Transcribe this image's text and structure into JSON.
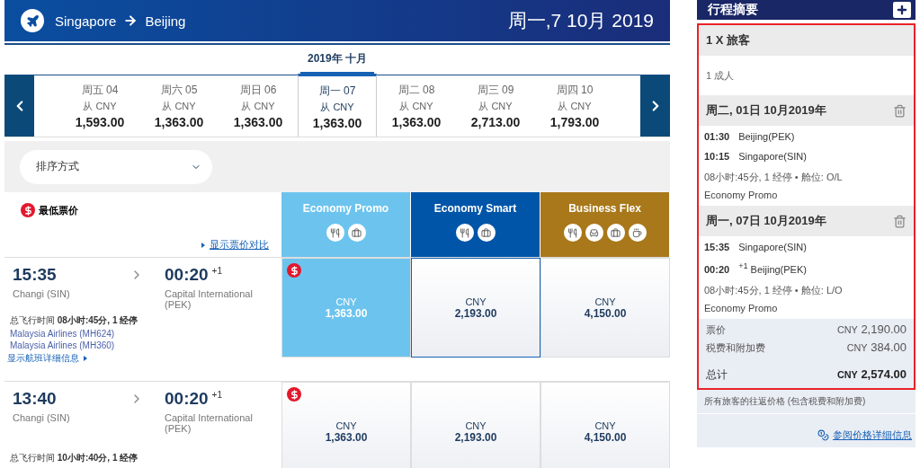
{
  "header": {
    "origin": "Singapore",
    "destination": "Beijing",
    "date": "周一,7 10月 2019"
  },
  "month_label": "2019年 十月",
  "dates": [
    {
      "day": "周五 04",
      "from": "从 CNY",
      "price": "1,593.00",
      "selected": false
    },
    {
      "day": "周六 05",
      "from": "从 CNY",
      "price": "1,363.00",
      "selected": false
    },
    {
      "day": "周日 06",
      "from": "从 CNY",
      "price": "1,363.00",
      "selected": false
    },
    {
      "day": "周一 07",
      "from": "从 CNY",
      "price": "1,363.00",
      "selected": true
    },
    {
      "day": "周二 08",
      "from": "从 CNY",
      "price": "1,363.00",
      "selected": false
    },
    {
      "day": "周三 09",
      "from": "从 CNY",
      "price": "2,713.00",
      "selected": false
    },
    {
      "day": "周四 10",
      "from": "从 CNY",
      "price": "1,793.00",
      "selected": false
    }
  ],
  "sort": {
    "label": "排序方式"
  },
  "lowest_fare_label": "最低票价",
  "compare_link": "显示票价对比",
  "fare_classes": [
    {
      "name": "Economy Promo",
      "color": "#6cc4ee",
      "amenities": [
        {
          "kind": "meal"
        },
        {
          "kind": "baggage"
        }
      ]
    },
    {
      "name": "Economy Smart",
      "color": "#0055a8",
      "amenities": [
        {
          "kind": "meal"
        },
        {
          "kind": "baggage"
        }
      ]
    },
    {
      "name": "Business Flex",
      "color": "#a8781a",
      "amenities": [
        {
          "kind": "meal"
        },
        {
          "kind": "seat"
        },
        {
          "kind": "baggage"
        },
        {
          "kind": "lounge"
        }
      ]
    }
  ],
  "flights": [
    {
      "depart": "15:35",
      "arrive": "00:20",
      "plus_day": "+1",
      "origin": "Changi (SIN)",
      "destination": "Capital International (PEK)",
      "duration_label": "总飞行时间",
      "duration": "08小时:45分, 1 经停",
      "airlines": [
        "Malaysia Airlines (MH624)",
        "Malaysia Airlines (MH360)"
      ],
      "details_link": "显示航班详细信息",
      "fares": [
        {
          "currency": "CNY",
          "price": "1,363.00",
          "lowest": true,
          "selected": true,
          "focused": false
        },
        {
          "currency": "CNY",
          "price": "2,193.00",
          "lowest": false,
          "selected": false,
          "focused": true
        },
        {
          "currency": "CNY",
          "price": "4,150.00",
          "lowest": false,
          "selected": false,
          "focused": false
        }
      ]
    },
    {
      "depart": "13:40",
      "arrive": "00:20",
      "plus_day": "+1",
      "origin": "Changi (SIN)",
      "destination": "Capital International (PEK)",
      "duration_label": "总飞行时间",
      "duration": "10小时:40分, 1 经停",
      "fares": [
        {
          "currency": "CNY",
          "price": "1,363.00",
          "lowest": true,
          "selected": false,
          "focused": false
        },
        {
          "currency": "CNY",
          "price": "2,193.00",
          "lowest": false,
          "selected": false,
          "focused": false
        },
        {
          "currency": "CNY",
          "price": "4,150.00",
          "lowest": false,
          "selected": false,
          "focused": false
        }
      ]
    }
  ],
  "summary": {
    "title": "行程摘要",
    "passengers_heading": "1 X 旅客",
    "passengers": "1 成人",
    "segments": [
      {
        "date": "周二, 01日 10月2019年",
        "stops": [
          {
            "time": "01:30",
            "place": "Beijing(PEK)"
          },
          {
            "time": "10:15",
            "place": "Singapore(SIN)"
          }
        ],
        "info": "08小时:45分, 1 经停 • 舱位: O/L",
        "cabin": "Economy Promo"
      },
      {
        "date": "周一, 07日 10月2019年",
        "stops": [
          {
            "time": "15:35",
            "place": "Singapore(SIN)"
          },
          {
            "time": "00:20",
            "plus_day": "+1",
            "place": "Beijing(PEK)"
          }
        ],
        "info": "08小时:45分, 1 经停 • 舱位: L/O",
        "cabin": "Economy Promo"
      }
    ],
    "lines": [
      {
        "label": "票价",
        "currency": "CNY",
        "amount": "2,190.00"
      },
      {
        "label": "税费和附加费",
        "currency": "CNY",
        "amount": "384.00"
      }
    ],
    "total": {
      "label": "总计",
      "currency": "CNY",
      "amount": "2,574.00"
    },
    "note": "所有旅客的往返价格 (包含税费和附加费)",
    "details_link": "参阅价格详细信息"
  }
}
